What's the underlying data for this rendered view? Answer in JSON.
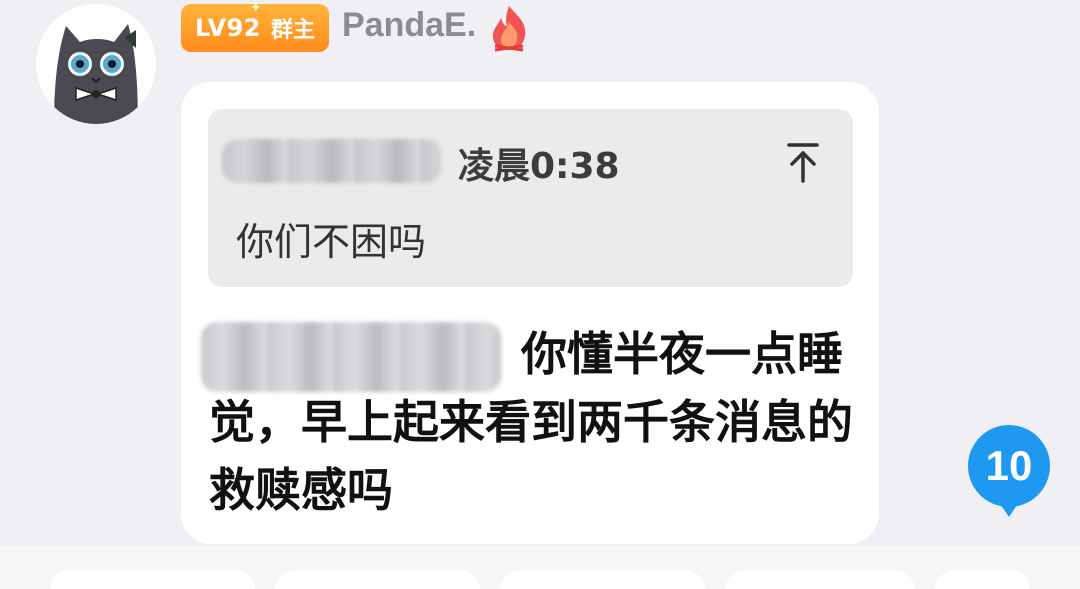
{
  "sender": {
    "level": "LV92",
    "role": "群主",
    "name": "PandaE.",
    "avatar_icon": "cat-avatar-icon",
    "badge_color": "#ff9a28"
  },
  "quote": {
    "time": "凌晨0:38",
    "text": "你们不困吗"
  },
  "message": {
    "text": "你懂半夜一点睡觉，早上起来看到两千条消息的救赎感吗"
  },
  "unread": {
    "count": "10",
    "color": "#1e98f1"
  }
}
